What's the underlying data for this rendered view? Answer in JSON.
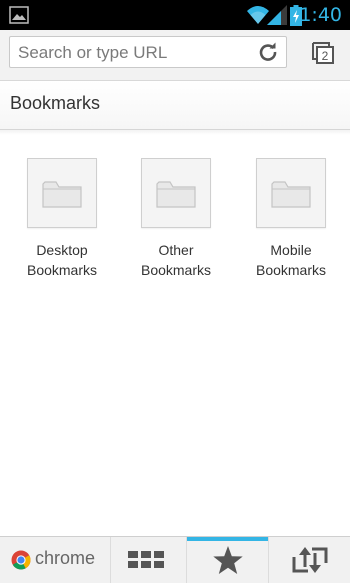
{
  "status_bar": {
    "time": "1:40",
    "icons": [
      "image-notification-icon",
      "wifi-icon",
      "signal-icon",
      "battery-icon"
    ],
    "clock_color": "#33b5e5"
  },
  "toolbar": {
    "url_placeholder": "Search or type URL",
    "tab_count": "2",
    "reload_icon": "reload-icon"
  },
  "header": {
    "title": "Bookmarks"
  },
  "folders": [
    {
      "label": "Desktop\nBookmarks",
      "icon": "folder-icon"
    },
    {
      "label": "Other\nBookmarks",
      "icon": "folder-icon"
    },
    {
      "label": "Mobile\nBookmarks",
      "icon": "folder-icon"
    }
  ],
  "bottom_bar": {
    "brand": "chrome",
    "items": [
      {
        "name": "most-visited",
        "icon": "grid-icon"
      },
      {
        "name": "bookmarks",
        "icon": "star-icon",
        "active": true
      },
      {
        "name": "history",
        "icon": "sync-arrows-icon"
      }
    ],
    "accent_color": "#33b5e5"
  }
}
